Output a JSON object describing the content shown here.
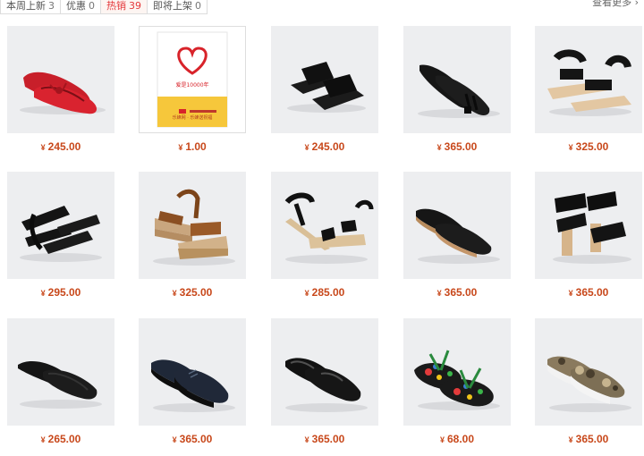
{
  "tabs": [
    {
      "label": "本周上新",
      "count": "3",
      "active": false
    },
    {
      "label": "优惠",
      "count": "0",
      "active": false
    },
    {
      "label": "热销",
      "count": "39",
      "active": true
    },
    {
      "label": "即将上架",
      "count": "0",
      "active": false
    }
  ],
  "more_link": "查看更多 ›",
  "currency_symbol": "¥",
  "gift_card": {
    "text": "爱是10000年",
    "brand_text": "乐蜂网 · 乐蜂送祝福"
  },
  "products": [
    {
      "price": "245.00",
      "icon": "red-ballet-flat"
    },
    {
      "price": "1.00",
      "icon": "gift-card-heart"
    },
    {
      "price": "245.00",
      "icon": "black-slide-sandal"
    },
    {
      "price": "365.00",
      "icon": "black-tassel-loafer"
    },
    {
      "price": "325.00",
      "icon": "black-strap-sandal"
    },
    {
      "price": "295.00",
      "icon": "black-wrap-sandal"
    },
    {
      "price": "325.00",
      "icon": "tan-platform-sandal"
    },
    {
      "price": "285.00",
      "icon": "black-ankle-strap-sandal"
    },
    {
      "price": "365.00",
      "icon": "black-platform-loafer"
    },
    {
      "price": "365.00",
      "icon": "black-heeled-sandal"
    },
    {
      "price": "265.00",
      "icon": "black-slipper-loafer"
    },
    {
      "price": "365.00",
      "icon": "navy-patent-derby"
    },
    {
      "price": "365.00",
      "icon": "black-patent-derby"
    },
    {
      "price": "68.00",
      "icon": "floral-flip-flop"
    },
    {
      "price": "365.00",
      "icon": "camo-slip-on-sneaker"
    }
  ]
}
